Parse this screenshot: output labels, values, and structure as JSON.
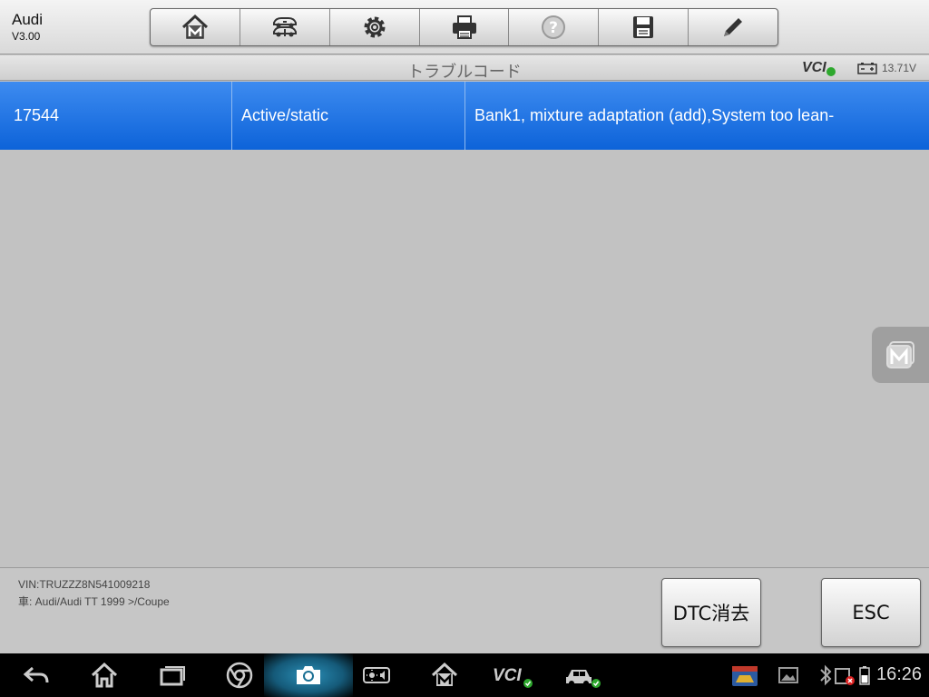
{
  "app": {
    "name": "Audi",
    "version": "V3.00"
  },
  "toolbar": {
    "buttons": [
      {
        "id": "home",
        "icon": "home-m-icon"
      },
      {
        "id": "vehicle-swap",
        "icon": "vehicle-swap-icon"
      },
      {
        "id": "settings",
        "icon": "gear-icon"
      },
      {
        "id": "print",
        "icon": "printer-icon"
      },
      {
        "id": "help",
        "icon": "help-icon"
      },
      {
        "id": "save",
        "icon": "save-icon"
      },
      {
        "id": "edit",
        "icon": "pencil-icon"
      }
    ]
  },
  "titlebar": {
    "title": "トラブルコード",
    "vci": "VCI",
    "voltage": "13.71V"
  },
  "dtc": {
    "rows": [
      {
        "code": "17544",
        "status": "Active/static",
        "description": "Bank1, mixture adaptation (add),System too lean-"
      }
    ]
  },
  "footer": {
    "vin": "VIN:TRUZZZ8N541009218",
    "vehicle": "車: Audi/Audi TT 1999 >/Coupe",
    "clear_label": "DTC消去",
    "esc_label": "ESC"
  },
  "status": {
    "time": "16:26",
    "vci_label": "VCI"
  },
  "colors": {
    "accent": "#1a6fe0",
    "ok": "#2ea82e"
  }
}
